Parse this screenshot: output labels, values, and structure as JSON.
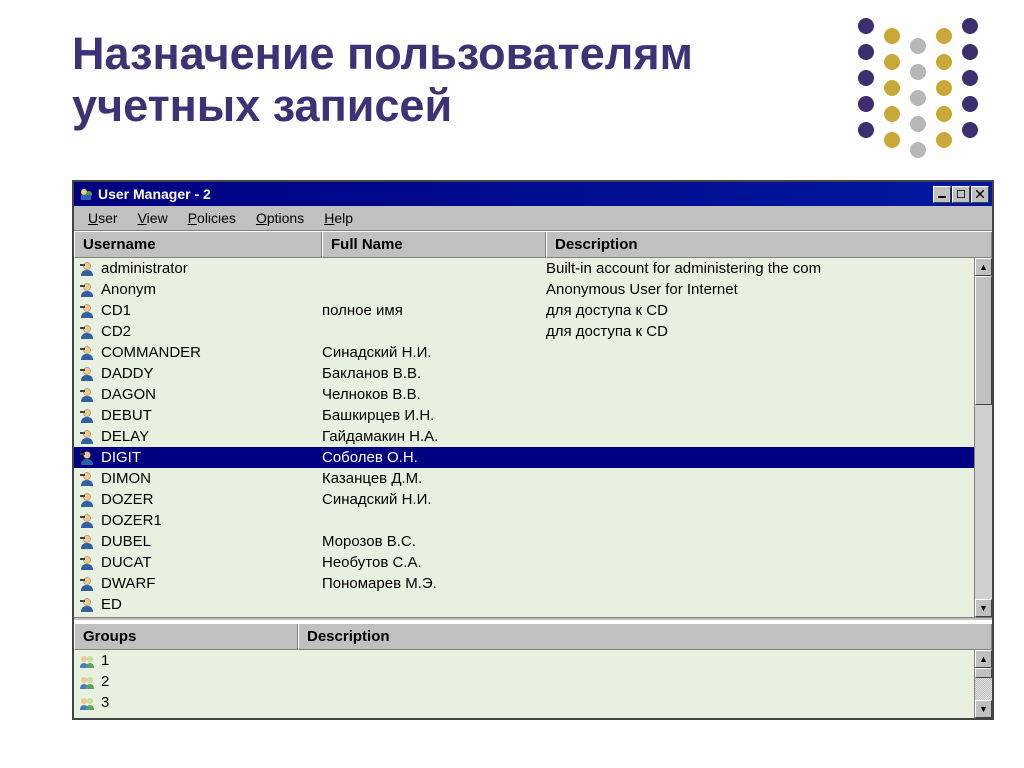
{
  "slide": {
    "title_line1": "Назначение пользователям",
    "title_line2": "учетных записей"
  },
  "window": {
    "title": "User Manager - 2"
  },
  "menu": {
    "user": "User",
    "view": "View",
    "policies": "Policies",
    "options": "Options",
    "help": "Help"
  },
  "columns": {
    "username": "Username",
    "fullname": "Full Name",
    "description": "Description",
    "groups": "Groups"
  },
  "users": [
    {
      "u": "administrator",
      "f": "",
      "d": "Built-in account for administering the com",
      "sel": false
    },
    {
      "u": "Anonym",
      "f": "",
      "d": "Anonymous User for Internet",
      "sel": false
    },
    {
      "u": "CD1",
      "f": "полное имя",
      "d": "для доступа к CD",
      "sel": false
    },
    {
      "u": "CD2",
      "f": "",
      "d": "для доступа к CD",
      "sel": false
    },
    {
      "u": "COMMANDER",
      "f": "Синадский Н.И.",
      "d": "",
      "sel": false
    },
    {
      "u": "DADDY",
      "f": "Бакланов В.В.",
      "d": "",
      "sel": false
    },
    {
      "u": "DAGON",
      "f": "Челноков В.В.",
      "d": "",
      "sel": false
    },
    {
      "u": "DEBUT",
      "f": "Башкирцев И.Н.",
      "d": "",
      "sel": false
    },
    {
      "u": "DELAY",
      "f": "Гайдамакин Н.А.",
      "d": "",
      "sel": false
    },
    {
      "u": "DIGIT",
      "f": "Соболев О.Н.",
      "d": "",
      "sel": true
    },
    {
      "u": "DIMON",
      "f": "Казанцев Д.М.",
      "d": "",
      "sel": false
    },
    {
      "u": "DOZER",
      "f": "Синадский Н.И.",
      "d": "",
      "sel": false
    },
    {
      "u": "DOZER1",
      "f": "",
      "d": "",
      "sel": false
    },
    {
      "u": "DUBEL",
      "f": "Морозов В.С.",
      "d": "",
      "sel": false
    },
    {
      "u": "DUCAT",
      "f": "Необутов С.А.",
      "d": "",
      "sel": false
    },
    {
      "u": "DWARF",
      "f": "Пономарев М.Э.",
      "d": "",
      "sel": false
    },
    {
      "u": "ED",
      "f": "",
      "d": "",
      "sel": false
    }
  ],
  "groups": [
    {
      "name": "1",
      "desc": ""
    },
    {
      "name": "2",
      "desc": ""
    },
    {
      "name": "3",
      "desc": ""
    }
  ],
  "deco_dots": {
    "colors": {
      "purple": "#3d2f6f",
      "gold": "#c7a838",
      "gray": "#b8b6b9"
    }
  }
}
